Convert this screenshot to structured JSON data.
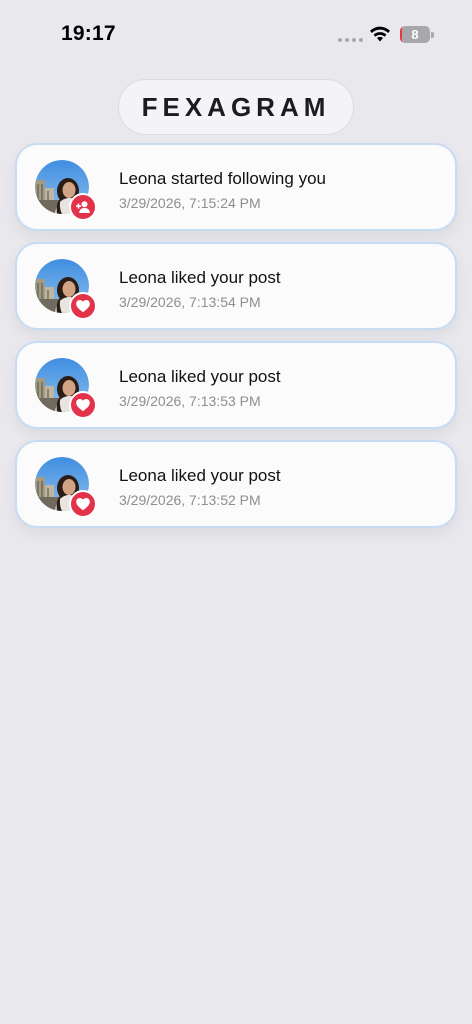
{
  "status_bar": {
    "time": "19:17",
    "battery_level": "8",
    "battery_fraction": 0.08,
    "icons": [
      "signal-dots-icon",
      "wifi-icon",
      "battery-icon"
    ]
  },
  "header": {
    "title": "FEXAGRAM"
  },
  "notifications": [
    {
      "text": "Leona started following you",
      "timestamp": "3/29/2026, 7:15:24 PM",
      "type": "follow",
      "badge_icon": "add-person-icon"
    },
    {
      "text": "Leona liked your post",
      "timestamp": "3/29/2026, 7:13:54 PM",
      "type": "like",
      "badge_icon": "heart-icon"
    },
    {
      "text": "Leona liked your post",
      "timestamp": "3/29/2026, 7:13:53 PM",
      "type": "like",
      "badge_icon": "heart-icon"
    },
    {
      "text": "Leona liked your post",
      "timestamp": "3/29/2026, 7:13:52 PM",
      "type": "like",
      "badge_icon": "heart-icon"
    }
  ],
  "colors": {
    "background": "#e9e8ed",
    "card_border": "#c7dbf3",
    "badge": "#e2334b",
    "timestamp": "#8e8e93"
  }
}
